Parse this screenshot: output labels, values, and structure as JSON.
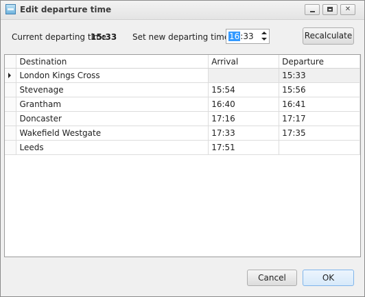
{
  "window": {
    "title": "Edit departure time",
    "controls": [
      "minimize",
      "maximize",
      "close"
    ]
  },
  "header": {
    "current_label": "Current departing time",
    "current_value": "15:33",
    "new_label": "Set new departing time",
    "new_value_selected": "16",
    "new_value_rest": ":33",
    "recalculate_label": "Recalculate"
  },
  "table": {
    "columns": [
      "Destination",
      "Arrival",
      "Departure"
    ],
    "rows": [
      {
        "destination": "London Kings Cross",
        "arrival": "",
        "departure": "15:33",
        "selected": true
      },
      {
        "destination": "Stevenage",
        "arrival": "15:54",
        "departure": "15:56"
      },
      {
        "destination": "Grantham",
        "arrival": "16:40",
        "departure": "16:41"
      },
      {
        "destination": "Doncaster",
        "arrival": "17:16",
        "departure": "17:17"
      },
      {
        "destination": "Wakefield Westgate",
        "arrival": "17:33",
        "departure": "17:35"
      },
      {
        "destination": "Leeds",
        "arrival": "17:51",
        "departure": ""
      }
    ]
  },
  "footer": {
    "cancel_label": "Cancel",
    "ok_label": "OK"
  }
}
